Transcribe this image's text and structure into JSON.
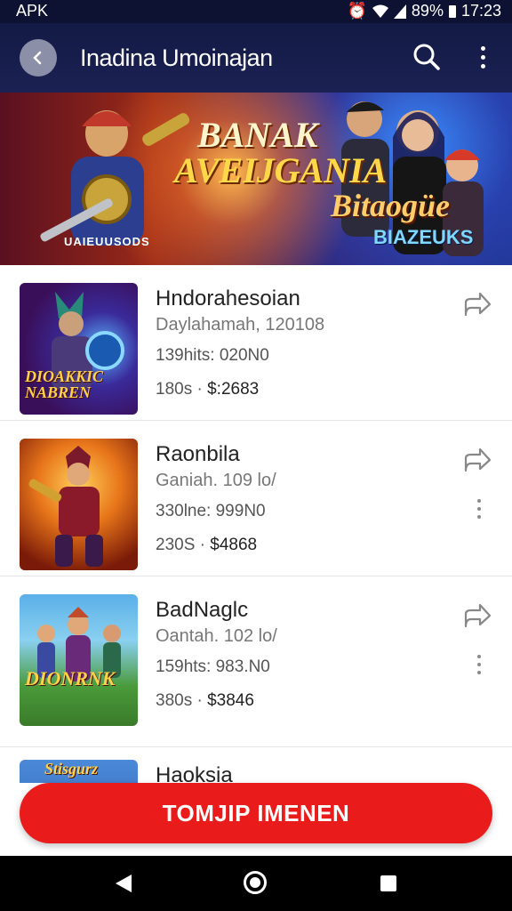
{
  "status_bar": {
    "left_label": "APK",
    "battery": "89%",
    "time": "17:23"
  },
  "app_bar": {
    "title": "Inadina Umoinajan"
  },
  "banner": {
    "line1": "BANAK",
    "line2": "AVEIJGANIA",
    "line3": "Bitaogüe",
    "line4": "BIAZEUKS",
    "caption": "UAIEUUSODS"
  },
  "items": [
    {
      "name": "Hndorahesoian",
      "subtitle": "Daylahamah, 120108",
      "duration": "139hits: 020N0",
      "price_prefix": "180s ·",
      "price": "$:2683",
      "thumb_label": "DIOAKKIC\nNABREN",
      "has_more": false
    },
    {
      "name": "Raonbila",
      "subtitle": "Ganiah. 109 lo/",
      "duration": "330lne: 999N0",
      "price_prefix": "230S ·",
      "price": "$4868",
      "thumb_label": "",
      "has_more": true
    },
    {
      "name": "BadNaglc",
      "subtitle": "Oantah. 102 lo/",
      "duration": "159hts: 983.N0",
      "price_prefix": "380s ·",
      "price": "$3846",
      "thumb_label": "DIONRNK",
      "has_more": true
    },
    {
      "name": "Haoksia",
      "subtitle": "",
      "duration": "",
      "price_prefix": "",
      "price": "",
      "thumb_label": "Stisgurz",
      "has_more": false
    }
  ],
  "cta": {
    "label": "TOMJIP IMENEN"
  },
  "colors": {
    "appbar": "#141a45",
    "cta": "#ea1b1b",
    "navbar": "#000000"
  }
}
